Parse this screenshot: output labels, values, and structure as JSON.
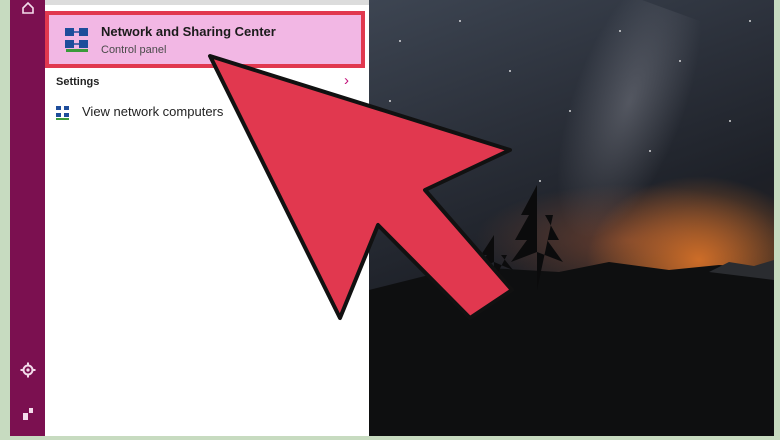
{
  "search_results": {
    "top_result": {
      "title": "Network and Sharing Center",
      "subtitle": "Control panel",
      "icon": "network-sharing-icon"
    },
    "settings_section": {
      "heading": "Settings",
      "chevron": "›",
      "items": [
        {
          "label": "View network computers",
          "icon": "network-computers-icon"
        }
      ]
    }
  },
  "rail": {
    "icons": [
      "home-icon",
      "settings-gear-icon",
      "power-user-icon"
    ]
  },
  "annotation": {
    "arrow_color": "#e1384f",
    "highlight_color": "#e1384f"
  },
  "colors": {
    "rail": "#7b1050",
    "highlight_fill": "#f2b7e4",
    "accent": "#c2127a"
  }
}
